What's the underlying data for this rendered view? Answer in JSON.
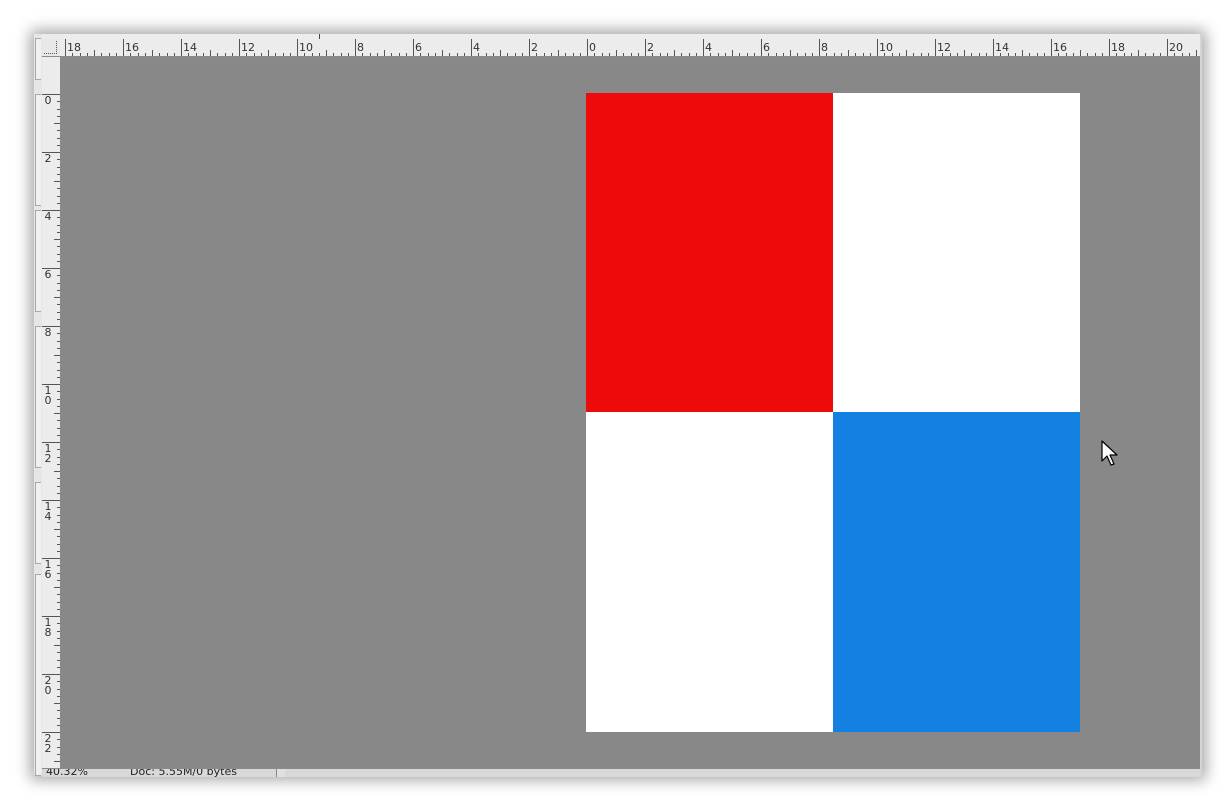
{
  "ruler_horizontal": {
    "labels": [
      "18",
      "16",
      "14",
      "12",
      "10",
      "8",
      "6",
      "4",
      "2",
      "0",
      "2",
      "4",
      "6",
      "8",
      "10",
      "12",
      "14",
      "16",
      "18",
      "20"
    ]
  },
  "ruler_vertical": {
    "labels": [
      "0",
      "2",
      "4",
      "6",
      "8",
      "1 0",
      "1 2",
      "1 4",
      "1 6",
      "1 8",
      "2 0",
      "2 2"
    ]
  },
  "document": {
    "quadrants": {
      "top_left": "#ee0a0a",
      "top_right": "#ffffff",
      "bottom_left": "#ffffff",
      "bottom_right": "#1480e2"
    }
  },
  "canvas_background": "#888888",
  "status": {
    "zoom": "40.32%",
    "doc_info": "Doc: 5.55M/0 bytes"
  },
  "cursor": "arrow-cursor-icon"
}
